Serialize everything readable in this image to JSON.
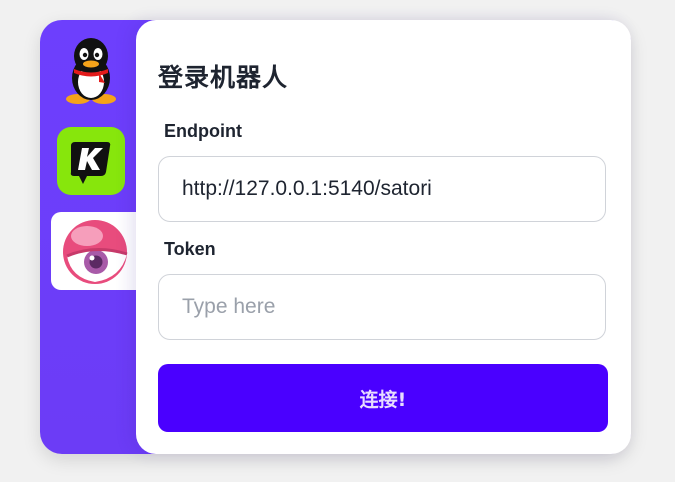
{
  "app": {
    "title": "登录机器人"
  },
  "platforms": [
    {
      "name": "qq-icon"
    },
    {
      "name": "kook-icon"
    },
    {
      "name": "satori-icon",
      "selected": true
    }
  ],
  "form": {
    "endpoint_label": "Endpoint",
    "endpoint_value": "http://127.0.0.1:5140/satori",
    "token_label": "Token",
    "token_placeholder": "Type here",
    "token_value": "",
    "connect_label": "连接!"
  },
  "colors": {
    "sidebar": "#6d3ffd",
    "accent": "#4a00ff",
    "background": "#f1f1f1"
  }
}
